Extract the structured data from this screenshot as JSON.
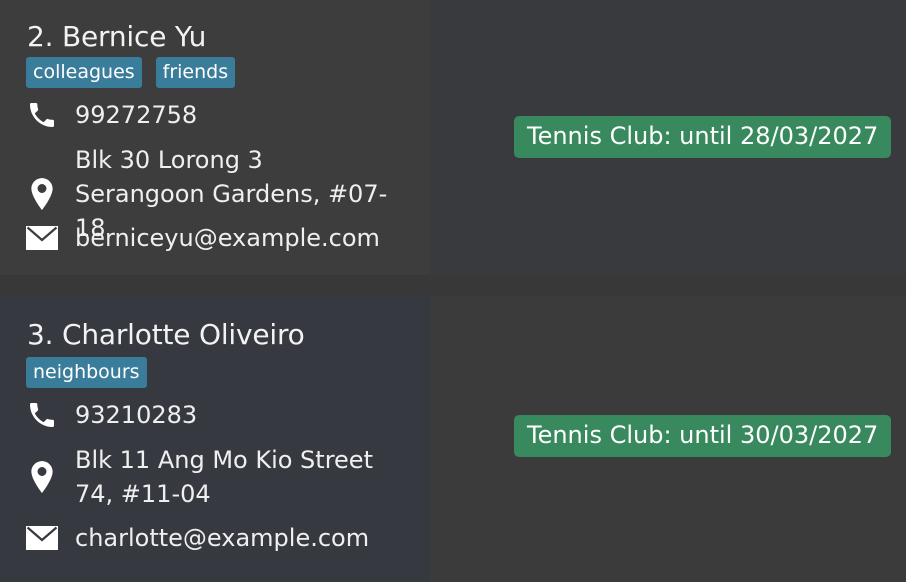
{
  "persons": [
    {
      "name": "2. Bernice Yu",
      "tags": [
        "colleagues",
        "friends"
      ],
      "phone": "99272758",
      "address": "Blk 30 Lorong 3 Serangoon Gardens, #07-18",
      "email": "berniceyu@example.com",
      "membership": "Tennis Club: until 28/03/2027"
    },
    {
      "name": "3. Charlotte Oliveiro",
      "tags": [
        "neighbours"
      ],
      "phone": "93210283",
      "address": "Blk 11 Ang Mo Kio Street 74, #11-04",
      "email": "charlotte@example.com",
      "membership": "Tennis Club: until 30/03/2027"
    }
  ],
  "icons": {
    "phone": "phone-icon",
    "address": "location-pin-icon",
    "email": "envelope-icon"
  },
  "colors": {
    "tag": "#3a7d9a",
    "membership": "#388a5e",
    "background": "#383838"
  }
}
